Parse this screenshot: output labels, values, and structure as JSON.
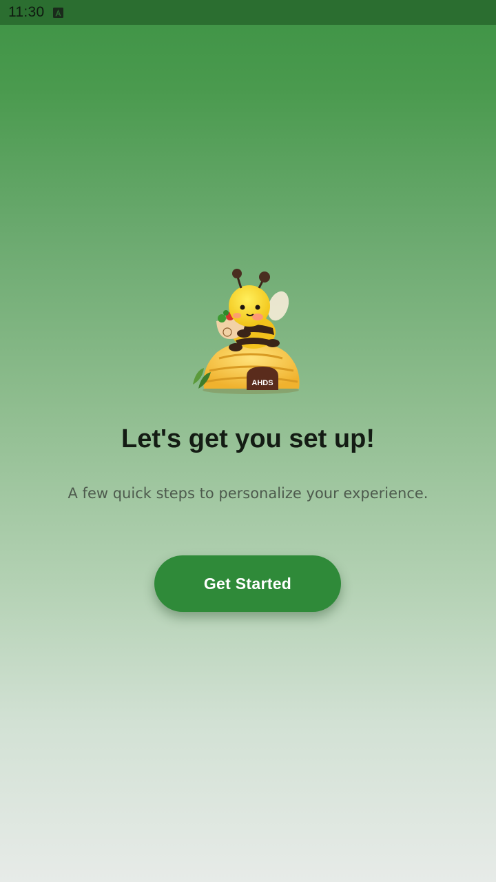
{
  "status_bar": {
    "time": "11:30",
    "notification_icon": "a-letter-icon"
  },
  "mascot": {
    "icon": "bee-on-beehive-icon",
    "hive_label": "AHDS"
  },
  "onboarding": {
    "title": "Let's get you set up!",
    "subtitle": "A few quick steps to personalize your experience.",
    "button_label": "Get Started"
  },
  "colors": {
    "primary": "#2f8a39",
    "status_bar": "#2b6e30",
    "gradient_top": "#3e9345",
    "gradient_bottom": "#e7ebe8"
  }
}
